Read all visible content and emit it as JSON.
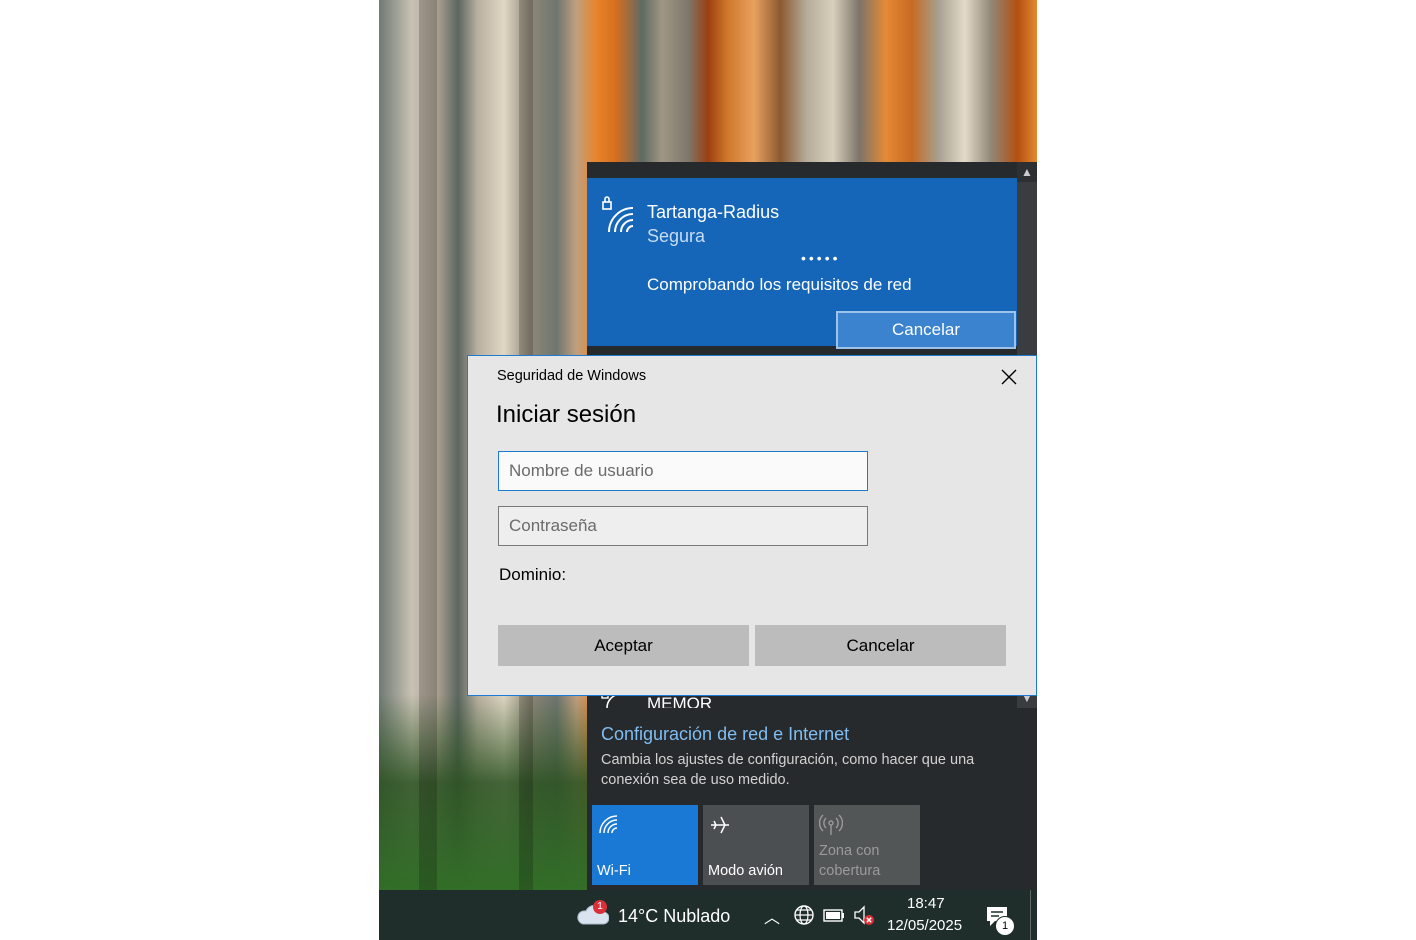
{
  "network_flyout": {
    "connecting_network": {
      "name": "Tartanga-Radius",
      "status": "Segura",
      "progress_dots": "•••••",
      "message": "Comprobando los requisitos de red",
      "cancel_label": "Cancelar"
    },
    "partial_network_name": "MEMOR",
    "settings_link": "Configuración de red e Internet",
    "settings_description": "Cambia los ajustes de configuración, como hacer que una conexión sea de uso medido.",
    "quick_actions": [
      {
        "label": "Wi-Fi",
        "icon": "wifi-icon",
        "state": "on"
      },
      {
        "label": "Modo avión",
        "icon": "airplane-icon",
        "state": "off"
      },
      {
        "label": "Zona con cobertura",
        "icon": "hotspot-icon",
        "state": "disabled"
      }
    ]
  },
  "dialog": {
    "title": "Seguridad de Windows",
    "heading": "Iniciar sesión",
    "username_placeholder": "Nombre de usuario",
    "password_placeholder": "Contraseña",
    "domain_label": "Dominio:",
    "ok_label": "Aceptar",
    "cancel_label": "Cancelar"
  },
  "taskbar": {
    "weather": {
      "text": "14°C  Nublado",
      "badge": "1"
    },
    "time": "18:47",
    "date": "12/05/2025",
    "notification_count": "1",
    "tray_icons": [
      "chevron-up-icon",
      "globe-icon",
      "battery-icon",
      "volume-muted-icon"
    ]
  },
  "colors": {
    "accent": "#1565b8",
    "wifi_tile": "#1a79d4",
    "dialog_border": "#1f7ad1",
    "flyout_bg": "#272a2c",
    "taskbar_bg": "#1f2e2a",
    "link": "#7fbdf2"
  }
}
